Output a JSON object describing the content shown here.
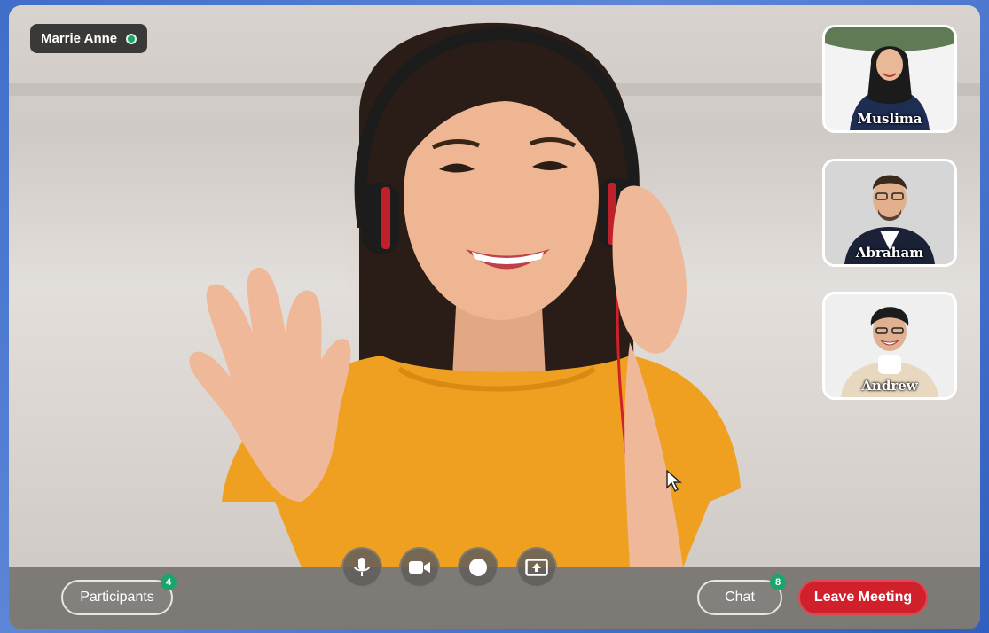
{
  "main_video": {
    "speaker_name": "Marrie Anne",
    "status": "online"
  },
  "participants_thumbs": [
    {
      "name": "Muslima"
    },
    {
      "name": "Abraham"
    },
    {
      "name": "Andrew"
    }
  ],
  "controls": {
    "participants_label": "Participants",
    "participants_count": "4",
    "chat_label": "Chat",
    "chat_count": "8",
    "leave_label": "Leave Meeting",
    "icons": [
      "microphone-icon",
      "video-camera-icon",
      "record-icon",
      "share-screen-icon"
    ]
  },
  "colors": {
    "leave": "#d0202b",
    "badge": "#1aa56a",
    "shirt": "#f0a020"
  }
}
